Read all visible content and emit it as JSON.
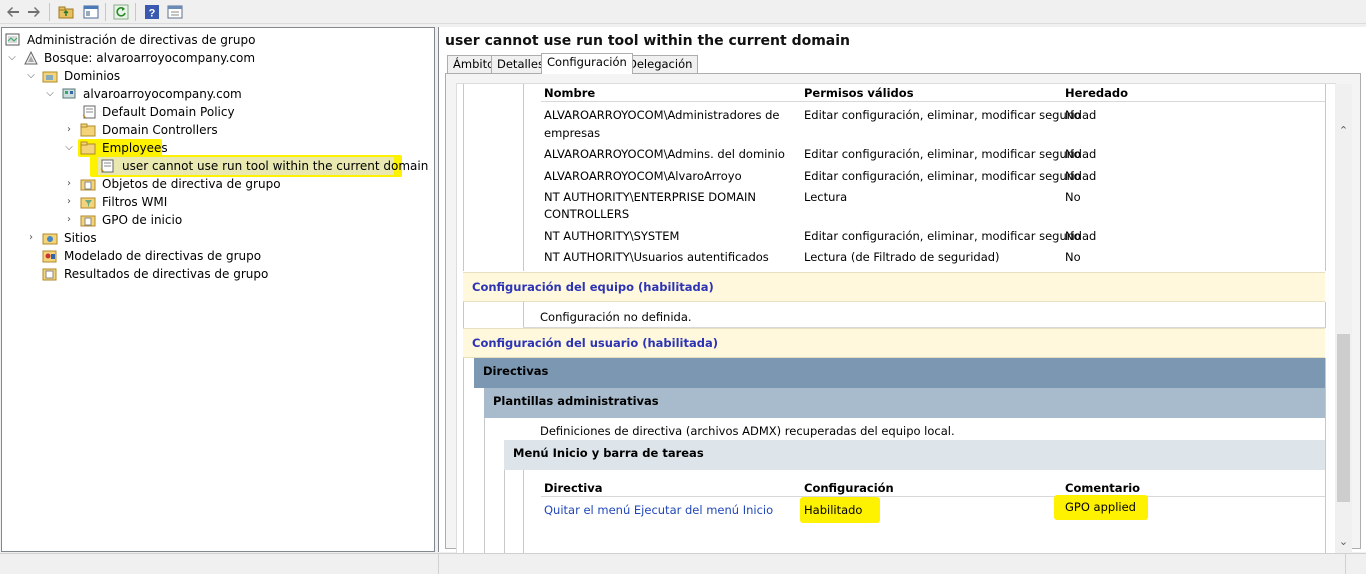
{
  "toolbar": {
    "icons": [
      "back-arrow-icon",
      "forward-arrow-icon",
      "up-folder-icon",
      "show-hide-tree-icon",
      "refresh-icon",
      "help-icon",
      "properties-icon"
    ]
  },
  "tree": {
    "root": "Administración de directivas de grupo",
    "forest": "Bosque: alvaroarroyocompany.com",
    "domains": "Dominios",
    "domain": "alvaroarroyocompany.com",
    "default_policy": "Default Domain Policy",
    "domain_controllers": "Domain Controllers",
    "employees": "Employees",
    "gpo_link": "user cannot use run tool within the current domain",
    "gpo_objects": "Objetos de directiva de grupo",
    "wmi_filters": "Filtros WMI",
    "starter_gpos": "GPO de inicio",
    "sites": "Sitios",
    "modeling": "Modelado de directivas de grupo",
    "results": "Resultados de directivas de grupo"
  },
  "right": {
    "title": "user cannot use run tool within the current domain",
    "tabs": [
      "Ámbito",
      "Detalles",
      "Configuración",
      "Delegación"
    ],
    "active_tab": "Configuración"
  },
  "delegation_table": {
    "headers": [
      "Nombre",
      "Permisos válidos",
      "Heredado"
    ],
    "rows": [
      {
        "name": "ALVAROARROYOCOM\\Administradores de",
        "name2": "empresas",
        "perm": "Editar configuración, eliminar, modificar seguridad",
        "inh": "No"
      },
      {
        "name": "ALVAROARROYOCOM\\Admins. del dominio",
        "perm": "Editar configuración, eliminar, modificar seguridad",
        "inh": "No"
      },
      {
        "name": "ALVAROARROYOCOM\\AlvaroArroyo",
        "perm": "Editar configuración, eliminar, modificar seguridad",
        "inh": "No"
      },
      {
        "name": "NT AUTHORITY\\ENTERPRISE DOMAIN",
        "name2": "CONTROLLERS",
        "perm": "Lectura",
        "inh": "No"
      },
      {
        "name": "NT AUTHORITY\\SYSTEM",
        "perm": "Editar configuración, eliminar, modificar seguridad",
        "inh": "No"
      },
      {
        "name": "NT AUTHORITY\\Usuarios autentificados",
        "perm": "Lectura (de Filtrado de seguridad)",
        "inh": "No"
      }
    ]
  },
  "computer_config": {
    "title": "Configuración del equipo (habilitada)",
    "note": "Configuración no definida."
  },
  "user_config": {
    "title": "Configuración del usuario (habilitada)",
    "policies": "Directivas",
    "admin_templates": "Plantillas administrativas",
    "admx_note": "Definiciones de directiva (archivos ADMX) recuperadas del equipo local.",
    "start_menu": "Menú Inicio y barra de tareas",
    "headers": [
      "Directiva",
      "Configuración",
      "Comentario"
    ],
    "policy_name": "Quitar el menú Ejecutar del menú Inicio",
    "policy_setting": "Habilitado",
    "policy_comment": "GPO applied"
  },
  "colors": {
    "highlight": "#fff200",
    "link": "#2047b8",
    "section_yellow": "#fff8dc",
    "section_dark": "#7b97b1",
    "section_mid": "#a7bbcc",
    "section_light": "#dde4ea"
  }
}
